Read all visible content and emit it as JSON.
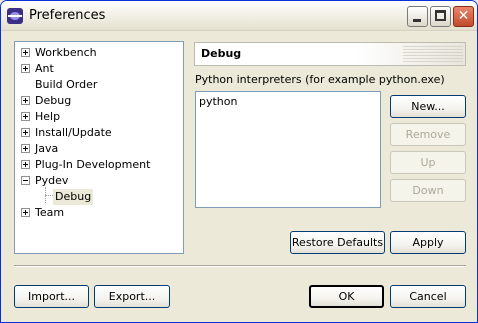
{
  "window": {
    "title": "Preferences"
  },
  "title_buttons": {
    "minimize": "minimize-icon",
    "maximize": "maximize-icon",
    "close": "✕"
  },
  "tree": {
    "items": [
      {
        "label": "Workbench",
        "expander": "plus"
      },
      {
        "label": "Ant",
        "expander": "plus"
      },
      {
        "label": "Build Order",
        "expander": "none"
      },
      {
        "label": "Debug",
        "expander": "plus"
      },
      {
        "label": "Help",
        "expander": "plus"
      },
      {
        "label": "Install/Update",
        "expander": "plus"
      },
      {
        "label": "Java",
        "expander": "plus"
      },
      {
        "label": "Plug-In Development",
        "expander": "plus"
      },
      {
        "label": "Pydev",
        "expander": "minus"
      },
      {
        "label": "Debug",
        "expander": "none",
        "child": true,
        "selected": true
      },
      {
        "label": "Team",
        "expander": "plus"
      }
    ]
  },
  "page": {
    "title": "Debug",
    "interpreters_label": "Python interpreters (for example python.exe)",
    "interpreters": [
      "python"
    ],
    "buttons": {
      "new": "New...",
      "remove": "Remove",
      "up": "Up",
      "down": "Down",
      "restore_defaults": "Restore Defaults",
      "apply": "Apply"
    }
  },
  "footer": {
    "import": "Import...",
    "export": "Export...",
    "ok": "OK",
    "cancel": "Cancel"
  },
  "colors": {
    "window_bg": "#ECE9D8",
    "border_blue": "#7F9DB9",
    "button_border": "#003C74",
    "close_red": "#C14A2D"
  }
}
